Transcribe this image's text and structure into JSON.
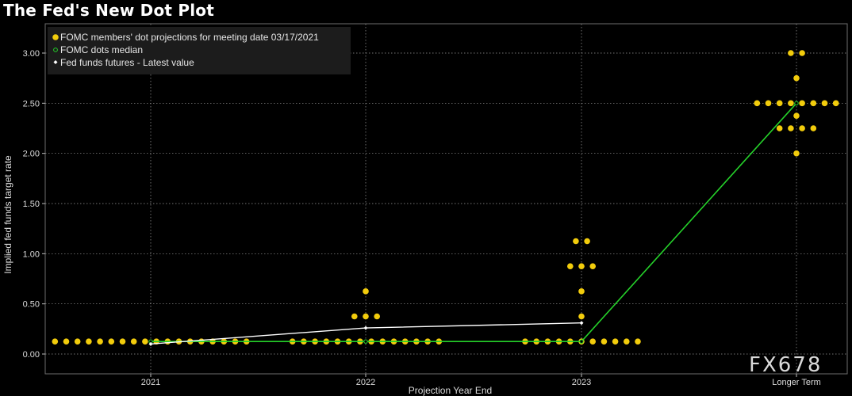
{
  "title": "The Fed's New Dot Plot",
  "watermark": "FX678",
  "colors": {
    "background": "#000000",
    "dots": "#f2cc0c",
    "median": "#25d12a",
    "futures": "#ffffff",
    "grid": "#9a9a9a"
  },
  "chart_data": {
    "type": "scatter",
    "xlabel": "Projection Year End",
    "ylabel": "Implied fed funds target rate",
    "categories": [
      "2021",
      "2022",
      "2023",
      "Longer Term"
    ],
    "ylim": [
      -0.2,
      3.3
    ],
    "yticks": [
      0.0,
      0.5,
      1.0,
      1.5,
      2.0,
      2.5,
      3.0
    ],
    "ytick_labels": [
      "0.00",
      "0.50",
      "1.00",
      "1.50",
      "2.00",
      "2.50",
      "3.00"
    ],
    "grid": true,
    "legend_position": "top-left",
    "legend": [
      "FOMC members' dot projections for meeting date 03/17/2021",
      "FOMC dots median",
      "Fed funds futures - Latest value"
    ],
    "dots": [
      {
        "category": "2021",
        "rows": [
          {
            "value": 0.125,
            "count": 18
          }
        ]
      },
      {
        "category": "2022",
        "rows": [
          {
            "value": 0.625,
            "count": 1
          },
          {
            "value": 0.375,
            "count": 3
          },
          {
            "value": 0.125,
            "count": 14
          }
        ]
      },
      {
        "category": "2023",
        "rows": [
          {
            "value": 1.125,
            "count": 2
          },
          {
            "value": 0.875,
            "count": 3
          },
          {
            "value": 0.625,
            "count": 1
          },
          {
            "value": 0.375,
            "count": 1
          },
          {
            "value": 0.125,
            "count": 11
          }
        ]
      },
      {
        "category": "Longer Term",
        "rows": [
          {
            "value": 3.0,
            "count": 2
          },
          {
            "value": 2.75,
            "count": 1
          },
          {
            "value": 2.5,
            "count": 8
          },
          {
            "value": 2.375,
            "count": 1
          },
          {
            "value": 2.25,
            "count": 4
          },
          {
            "value": 2.0,
            "count": 1
          }
        ]
      }
    ],
    "series": [
      {
        "name": "FOMC dots median",
        "x": [
          "2021",
          "2022",
          "2023",
          "Longer Term"
        ],
        "values": [
          0.125,
          0.125,
          0.125,
          2.5
        ]
      },
      {
        "name": "Fed funds futures - Latest value",
        "x": [
          "2021",
          "2022",
          "2023"
        ],
        "values": [
          0.1,
          0.26,
          0.31
        ]
      }
    ]
  }
}
